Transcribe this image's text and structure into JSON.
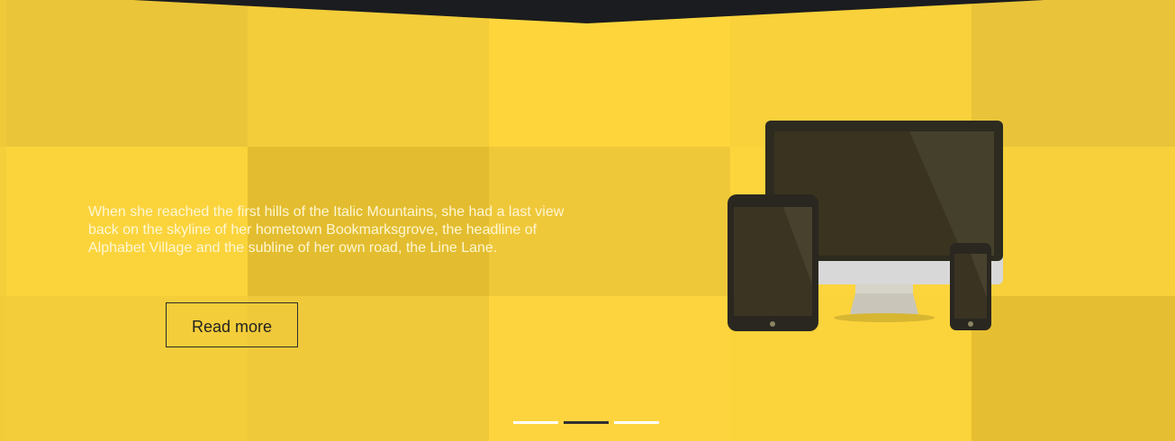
{
  "hero": {
    "text": "When she reached the first hills of the Italic Mountains, she had a last view back on the skyline of her hometown Bookmarksgrove, the headline of Alphabet Village and the subline of her own road, the Line Lane.",
    "button_label": "Read more"
  },
  "slider": {
    "slides": 3,
    "active_index": 1
  },
  "colors": {
    "background": "#f6d039",
    "top_band": "#1b1c1f",
    "button_border": "#2b2b2b",
    "text": "#fff6d3",
    "dot": "#ffffff",
    "dot_active": "#2f2f2f"
  }
}
